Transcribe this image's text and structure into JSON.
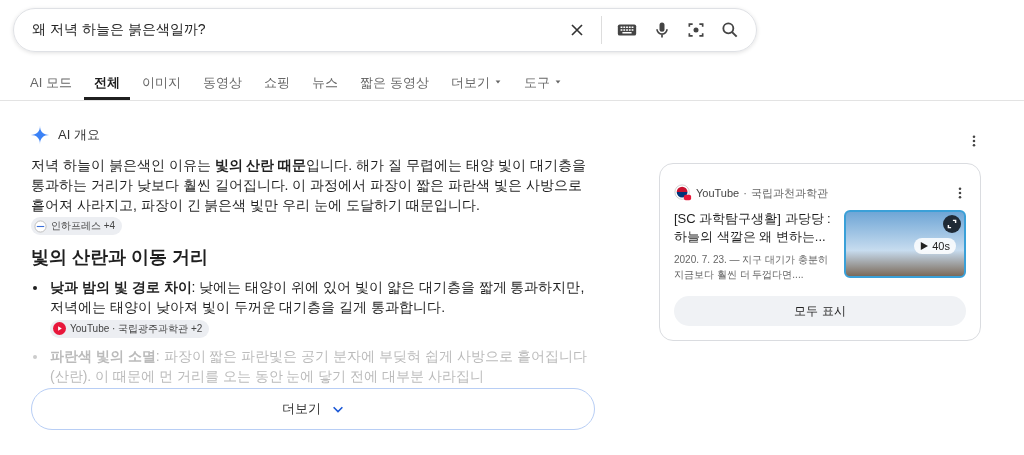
{
  "search": {
    "value": "왜 저녁 하늘은 붉은색일까?"
  },
  "tabs": [
    {
      "label": "AI 모드",
      "selected": false,
      "dropdown": false
    },
    {
      "label": "전체",
      "selected": true,
      "dropdown": false
    },
    {
      "label": "이미지",
      "selected": false,
      "dropdown": false
    },
    {
      "label": "동영상",
      "selected": false,
      "dropdown": false
    },
    {
      "label": "쇼핑",
      "selected": false,
      "dropdown": false
    },
    {
      "label": "뉴스",
      "selected": false,
      "dropdown": false
    },
    {
      "label": "짧은 동영상",
      "selected": false,
      "dropdown": false
    },
    {
      "label": "더보기",
      "selected": false,
      "dropdown": true
    },
    {
      "label": "도구",
      "selected": false,
      "dropdown": true
    }
  ],
  "overview": {
    "title": "AI 개요",
    "summary": "저녁 하늘이 붉은색인 이유는 **빛의 산란 때문**입니다. 해가 질 무렵에는 태양 빛이 대기층을 통과하는 거리가 낮보다 훨씬 길어집니다. 이 과정에서 파장이 짧은 파란색 빛은 사방으로 흩어져 사라지고, 파장이 긴 붉은색 빛만 우리 눈에 도달하기 때문입니다.",
    "summary_source": {
      "kind": "site",
      "label": "인하프레스 +4"
    },
    "heading": "빛의 산란과 이동 거리",
    "bullets": [
      {
        "term": "낮과 밤의 빛 경로 차이",
        "text": ": 낮에는 태양이 위에 있어 빛이 얇은 대기층을 짧게 통과하지만, 저녁에는 태양이 낮아져 빛이 두꺼운 대기층을 길게 통과합니다.",
        "faded": false,
        "source": {
          "kind": "youtube",
          "label": "YouTube · 국립광주과학관 +2"
        }
      },
      {
        "term": "파란색 빛의 소멸",
        "text": ": 파장이 짧은 파란빛은 공기 분자에 부딪혀 쉽게 사방으로 흩어집니다(산란). 이 때문에 먼 거리를 오는 동안 눈에 닿기 전에 대부분 사라집니",
        "faded": true
      }
    ],
    "more_button": "더보기"
  },
  "video_card": {
    "source": "YouTube",
    "separator": "·",
    "channel": "국립과천과학관",
    "title": "[SC 과학탐구생활] 과당당 : 하늘의 색깔은 왜 변하는...",
    "snippet": "2020. 7. 23. — 지구 대기가 충분히 지금보다 훨씬 더 두껍다면....",
    "duration": "40s",
    "show_all": "모두 표시"
  }
}
